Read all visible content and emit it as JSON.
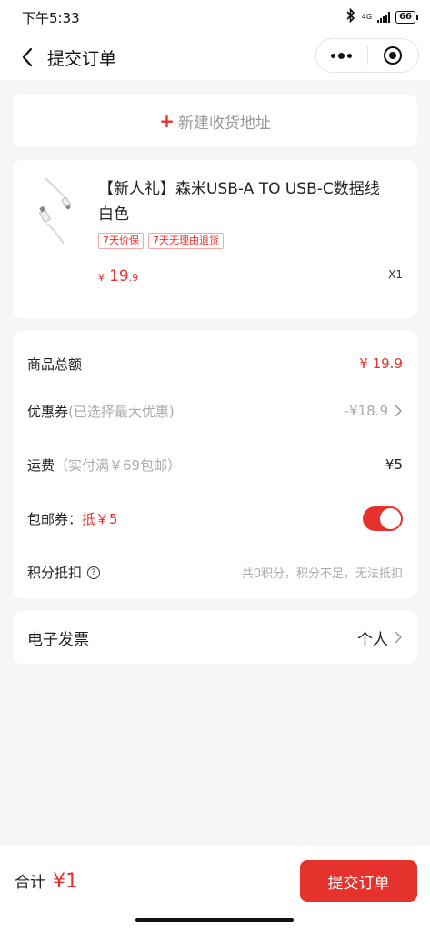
{
  "status_bar": {
    "time": "下午5:33",
    "network": "4G",
    "battery": "66"
  },
  "nav": {
    "title": "提交订单"
  },
  "address": {
    "plus": "+",
    "label": "新建收货地址"
  },
  "product": {
    "title": "【新人礼】森米USB-A TO USB-C数据线 白色",
    "tags": [
      "7天价保",
      "7天无理由退货"
    ],
    "price_symbol": "¥",
    "price_int": "19",
    "price_dec": ".9",
    "quantity": "X1"
  },
  "summary": {
    "goods_total_label": "商品总额",
    "goods_total_value": "¥ 19.9",
    "coupon_label": "优惠券",
    "coupon_note": "(已选择最大优惠)",
    "coupon_value": "-¥18.9",
    "shipping_label": "运费",
    "shipping_note": "（实付满￥69包邮）",
    "shipping_value": "¥5",
    "free_ship_label": "包邮券：",
    "free_ship_value": "抵￥5",
    "free_ship_enabled": true,
    "points_label": "积分抵扣",
    "points_help": "?",
    "points_note": "共0积分，积分不足，无法抵扣"
  },
  "invoice": {
    "label": "电子发票",
    "value": "个人"
  },
  "footer": {
    "total_label": "合计",
    "total_value": "¥1",
    "submit_label": "提交订单"
  },
  "colors": {
    "accent": "#e5322d",
    "background": "#f5f6f8"
  },
  "icons": [
    "back-arrow-icon",
    "more-dots-icon",
    "target-icon",
    "bluetooth-icon",
    "signal-icon",
    "battery-icon",
    "chevron-right-icon",
    "help-circle-icon"
  ]
}
